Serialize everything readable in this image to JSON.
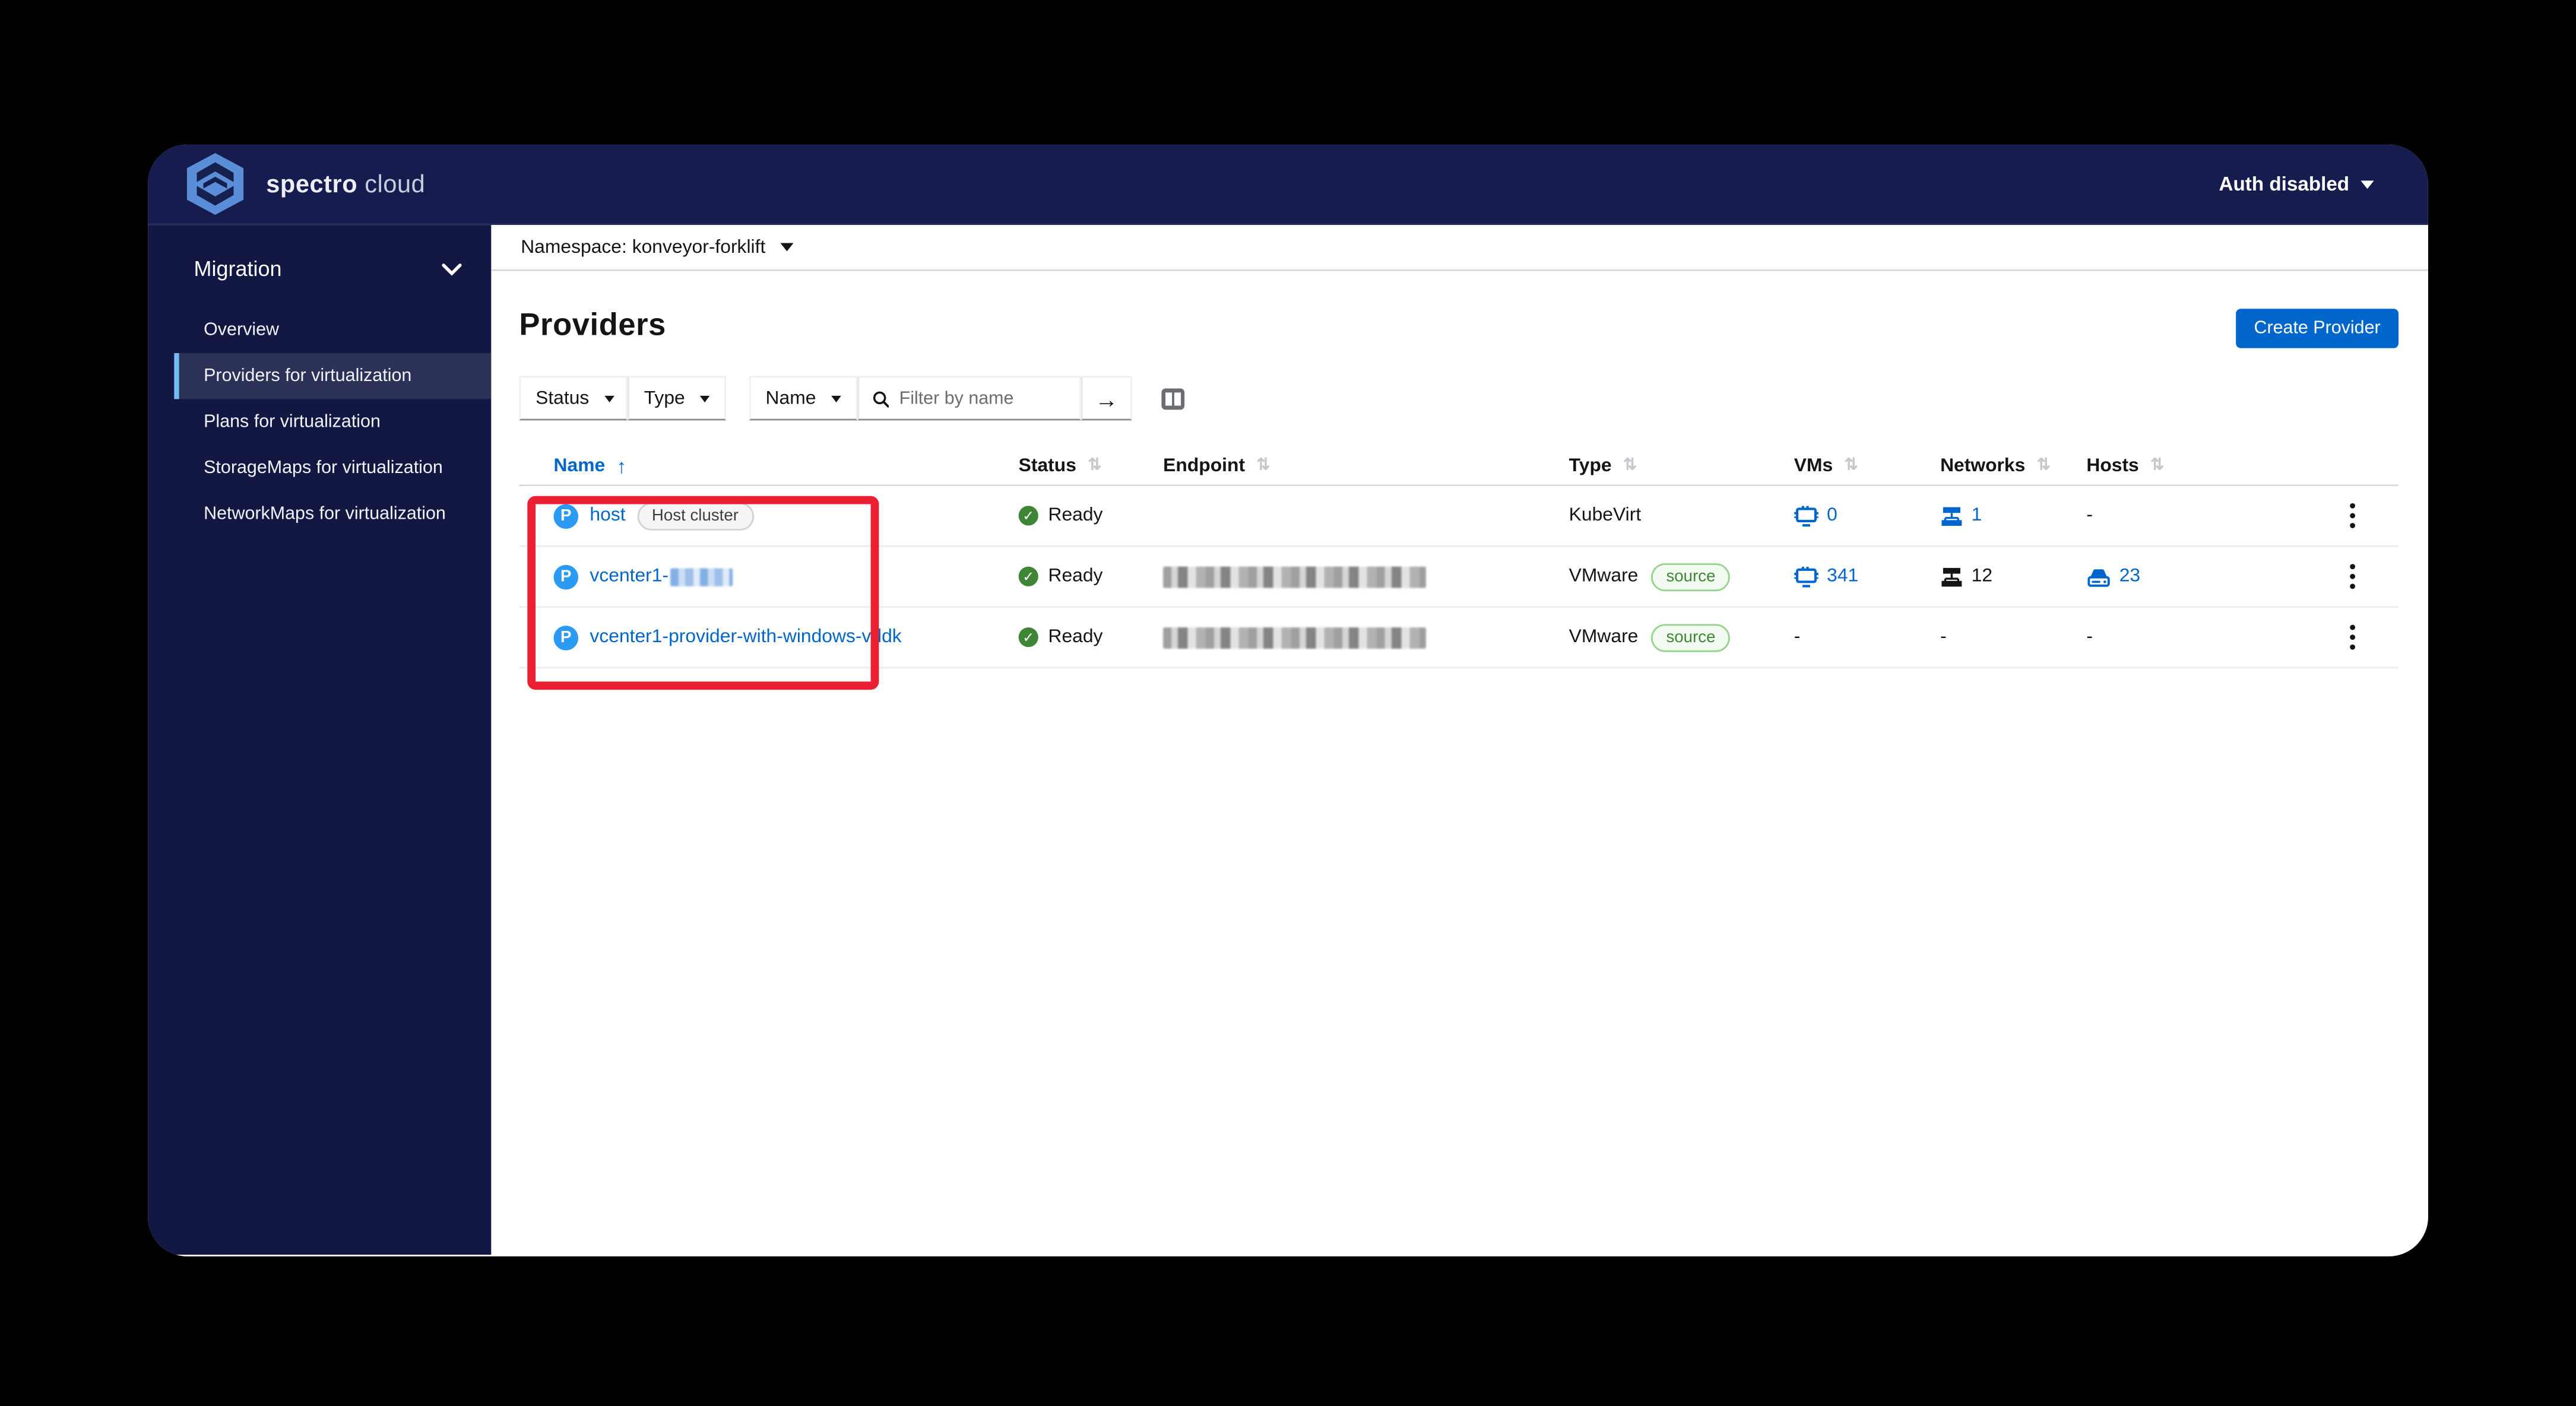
{
  "topbar": {
    "brand_bold": "spectro",
    "brand_light": "cloud",
    "auth_label": "Auth disabled"
  },
  "sidebar": {
    "group_label": "Migration",
    "items": [
      {
        "label": "Overview",
        "selected": false
      },
      {
        "label": "Providers for virtualization",
        "selected": true
      },
      {
        "label": "Plans for virtualization",
        "selected": false
      },
      {
        "label": "StorageMaps for virtualization",
        "selected": false
      },
      {
        "label": "NetworkMaps for virtualization",
        "selected": false
      }
    ]
  },
  "namespace_bar": {
    "label": "Namespace: konveyor-forklift"
  },
  "page": {
    "title": "Providers",
    "create_button_label": "Create Provider"
  },
  "toolbar": {
    "status_label": "Status",
    "type_label": "Type",
    "name_label": "Name",
    "filter_placeholder": "Filter by name",
    "filter_value": "",
    "arrow_label": "→"
  },
  "table": {
    "columns": {
      "name": "Name",
      "status": "Status",
      "endpoint": "Endpoint",
      "type": "Type",
      "vms": "VMs",
      "networks": "Networks",
      "hosts": "Hosts"
    },
    "sort": {
      "column": "Name",
      "direction": "ascending",
      "asc_glyph": "↑",
      "sort_glyph": "⇅"
    },
    "rows": [
      {
        "name": "host",
        "badge": "Host cluster",
        "status": "Ready",
        "endpoint": "",
        "type": "KubeVirt",
        "type_badge": "",
        "vms": "0",
        "networks": "1",
        "hosts": "-"
      },
      {
        "name": "vcenter1-",
        "name_redacted": true,
        "status": "Ready",
        "endpoint_redacted": true,
        "type": "VMware",
        "type_badge": "source",
        "vms": "341",
        "networks": "12",
        "hosts": "23"
      },
      {
        "name": "vcenter1-provider-with-windows-vddk",
        "status": "Ready",
        "endpoint_redacted": true,
        "type": "VMware",
        "type_badge": "source",
        "vms": "-",
        "networks": "-",
        "hosts": "-"
      }
    ]
  },
  "colors": {
    "accent_blue": "#0066cc",
    "topbar_navy": "#161d4e",
    "sidebar_navy": "#131843",
    "selected_item_bg": "#2c3157",
    "selected_item_border": "#73bcf7",
    "annotation_red": "#ec2033",
    "ready_green": "#3e8635",
    "provider_icon_blue": "#2b9af3"
  }
}
